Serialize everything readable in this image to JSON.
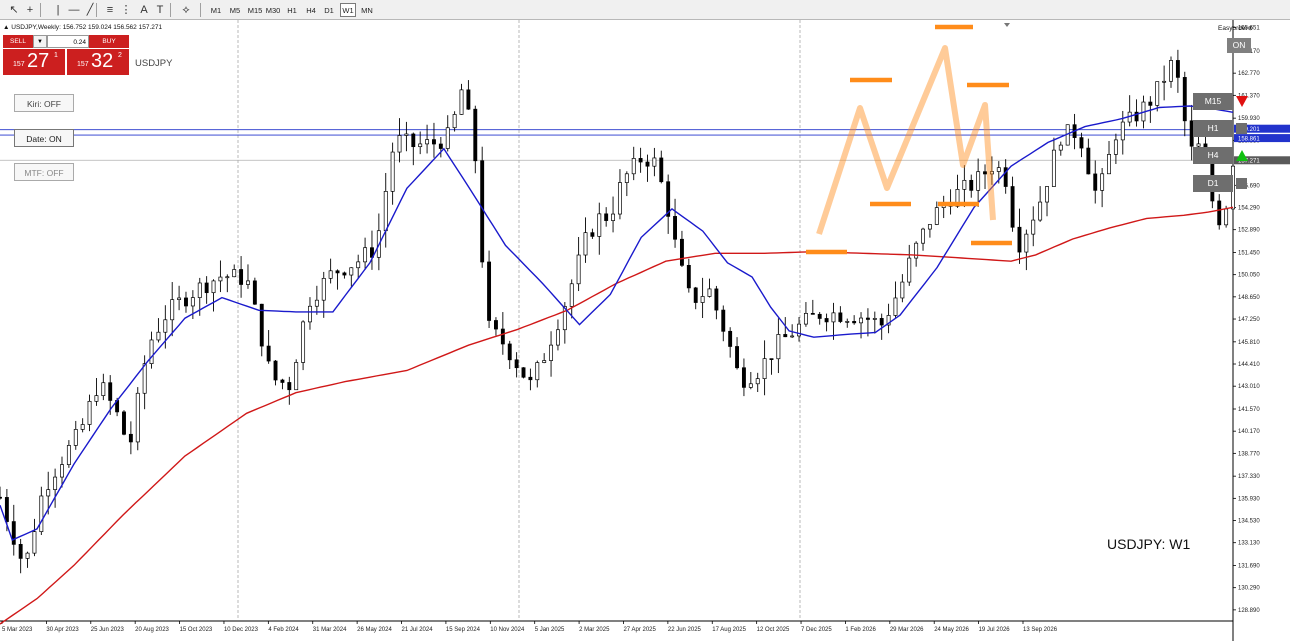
{
  "toolbar": {
    "tools": [
      "cursor-icon",
      "crosshair-icon",
      "vertical-line-icon",
      "horizontal-line-icon",
      "trendline-icon",
      "channel-icon",
      "fibonacci-icon",
      "text-icon",
      "label-icon",
      "shapes-icon"
    ],
    "timeframes": [
      "M1",
      "M5",
      "M15",
      "M30",
      "H1",
      "H4",
      "D1",
      "W1",
      "MN"
    ],
    "active_timeframe": "W1"
  },
  "chart": {
    "title": "USDJPY,Weekly",
    "ohlc": "156.752 159.024 156.562 157.271",
    "symbol": "USDJPY",
    "caption": "USDJPY: W1"
  },
  "trade_panel": {
    "sell_label": "SELL",
    "buy_label": "BUY",
    "lot": "0.24",
    "dropdown_icon": "▼",
    "sell_price_prefix": "157",
    "sell_price_big": "27",
    "sell_price_sup": "1",
    "buy_price_prefix": "157",
    "buy_price_big": "32",
    "buy_price_sup": "2"
  },
  "left_buttons": {
    "kiri": "Kiri: OFF",
    "date": "Date: ON",
    "mtf": "MTF: OFF"
  },
  "easyorder": {
    "label": "Easyorder",
    "on_label": "ON"
  },
  "mtf_panel": [
    {
      "label": "M15",
      "signal": "down",
      "color": "#e01010"
    },
    {
      "label": "H1",
      "signal": "neutral",
      "color": "#6e6e6e"
    },
    {
      "label": "H4",
      "signal": "up",
      "color": "#10c010"
    },
    {
      "label": "D1",
      "signal": "neutral",
      "color": "#6e6e6e"
    }
  ],
  "price_axis": [
    "165.651",
    "164.170",
    "162.770",
    "161.370",
    "159.930",
    "158.530",
    "155.690",
    "154.290",
    "152.890",
    "151.450",
    "150.050",
    "148.650",
    "147.250",
    "145.810",
    "144.410",
    "143.010",
    "141.570",
    "140.170",
    "138.770",
    "137.330",
    "135.930",
    "134.530",
    "133.130",
    "131.690",
    "130.290",
    "128.890"
  ],
  "price_markers": {
    "upper": "159.201",
    "upper2": "158.861",
    "current": "157.271"
  },
  "time_axis": [
    "5 Mar 2023",
    "30 Apr 2023",
    "25 Jun 2023",
    "20 Aug 2023",
    "15 Oct 2023",
    "10 Dec 2023",
    "4 Feb 2024",
    "31 Mar 2024",
    "26 May 2024",
    "21 Jul 2024",
    "15 Sep 2024",
    "10 Nov 2024",
    "5 Jan 2025",
    "2 Mar 2025",
    "27 Apr 2025",
    "22 Jun 2025",
    "17 Aug 2025",
    "12 Oct 2025",
    "7 Dec 2025",
    "1 Feb 2026",
    "29 Mar 2026",
    "24 May 2026",
    "19 Jul 2026",
    "13 Sep 2026"
  ],
  "chart_data": {
    "type": "candlestick",
    "y_range": [
      128.25,
      166.0
    ],
    "ma_fast_color": "#1a1acc",
    "ma_slow_color": "#d01818",
    "pattern_color": "#ff8c1a",
    "ma_fast_key": [
      [
        0,
        135.5
      ],
      [
        10,
        133.3
      ],
      [
        30,
        134.0
      ],
      [
        60,
        138.1
      ],
      [
        90,
        141.6
      ],
      [
        120,
        144.6
      ],
      [
        150,
        147.3
      ],
      [
        180,
        148.6
      ],
      [
        210,
        147.8
      ],
      [
        240,
        147.7
      ],
      [
        270,
        147.7
      ],
      [
        300,
        150.8
      ],
      [
        330,
        155.5
      ],
      [
        360,
        158.0
      ],
      [
        380,
        155.6
      ],
      [
        410,
        151.9
      ],
      [
        440,
        149.5
      ],
      [
        470,
        146.9
      ],
      [
        495,
        148.8
      ],
      [
        520,
        152.4
      ],
      [
        545,
        154.2
      ],
      [
        570,
        152.8
      ],
      [
        590,
        150.8
      ],
      [
        610,
        149.9
      ],
      [
        625,
        148.0
      ],
      [
        640,
        146.5
      ],
      [
        660,
        146.1
      ],
      [
        690,
        146.3
      ],
      [
        710,
        146.4
      ],
      [
        730,
        147.5
      ],
      [
        760,
        150.5
      ],
      [
        790,
        154.3
      ],
      [
        820,
        156.9
      ],
      [
        850,
        158.4
      ],
      [
        880,
        159.4
      ],
      [
        910,
        159.9
      ],
      [
        940,
        160.6
      ],
      [
        965,
        160.7
      ],
      [
        985,
        160.5
      ],
      [
        1000,
        160.3
      ]
    ],
    "ma_slow_key": [
      [
        0,
        128.0
      ],
      [
        30,
        129.6
      ],
      [
        60,
        131.7
      ],
      [
        100,
        134.9
      ],
      [
        150,
        138.6
      ],
      [
        200,
        141.3
      ],
      [
        240,
        142.6
      ],
      [
        280,
        143.3
      ],
      [
        330,
        144.0
      ],
      [
        380,
        145.6
      ],
      [
        420,
        146.6
      ],
      [
        460,
        147.8
      ],
      [
        500,
        149.5
      ],
      [
        540,
        150.9
      ],
      [
        580,
        151.4
      ],
      [
        620,
        151.4
      ],
      [
        660,
        151.5
      ],
      [
        700,
        151.4
      ],
      [
        740,
        151.3
      ],
      [
        780,
        151.1
      ],
      [
        820,
        150.9
      ],
      [
        840,
        151.3
      ],
      [
        870,
        152.3
      ],
      [
        900,
        153.0
      ],
      [
        930,
        153.6
      ],
      [
        960,
        153.8
      ],
      [
        980,
        154.0
      ],
      [
        1000,
        154.3
      ]
    ],
    "close_key": [
      [
        0,
        136.0
      ],
      [
        10,
        133.8
      ],
      [
        20,
        131.5
      ],
      [
        35,
        136.5
      ],
      [
        50,
        138.4
      ],
      [
        65,
        140.1
      ],
      [
        80,
        143.3
      ],
      [
        95,
        141.2
      ],
      [
        105,
        139.1
      ],
      [
        120,
        145.6
      ],
      [
        135,
        147.6
      ],
      [
        150,
        148.6
      ],
      [
        165,
        149.4
      ],
      [
        180,
        150.0
      ],
      [
        200,
        149.8
      ],
      [
        210,
        146.8
      ],
      [
        220,
        143.5
      ],
      [
        235,
        143.1
      ],
      [
        250,
        148.4
      ],
      [
        270,
        150.2
      ],
      [
        290,
        150.9
      ],
      [
        305,
        151.8
      ],
      [
        320,
        158.6
      ],
      [
        335,
        158.2
      ],
      [
        350,
        158.3
      ],
      [
        365,
        158.8
      ],
      [
        375,
        161.9
      ],
      [
        385,
        157.9
      ],
      [
        395,
        146.8
      ],
      [
        410,
        145.6
      ],
      [
        430,
        143.1
      ],
      [
        440,
        144.7
      ],
      [
        460,
        148.6
      ],
      [
        475,
        152.2
      ],
      [
        485,
        153.6
      ],
      [
        495,
        153.8
      ],
      [
        505,
        156.0
      ],
      [
        520,
        157.4
      ],
      [
        530,
        157.3
      ],
      [
        540,
        154.9
      ],
      [
        550,
        151.0
      ],
      [
        560,
        148.4
      ],
      [
        575,
        149.1
      ],
      [
        590,
        146.0
      ],
      [
        600,
        143.4
      ],
      [
        615,
        144.0
      ],
      [
        630,
        145.6
      ],
      [
        650,
        146.9
      ],
      [
        665,
        147.6
      ],
      [
        680,
        147.6
      ],
      [
        700,
        147.4
      ],
      [
        715,
        146.9
      ],
      [
        730,
        149.2
      ],
      [
        740,
        151.3
      ],
      [
        755,
        153.6
      ],
      [
        770,
        154.9
      ],
      [
        790,
        155.8
      ],
      [
        805,
        157.0
      ],
      [
        815,
        156.4
      ],
      [
        825,
        151.8
      ],
      [
        835,
        153.3
      ],
      [
        845,
        155.0
      ],
      [
        860,
        158.8
      ],
      [
        875,
        159.1
      ],
      [
        890,
        154.8
      ],
      [
        905,
        159.0
      ],
      [
        920,
        160.0
      ],
      [
        935,
        161.2
      ],
      [
        950,
        163.3
      ],
      [
        955,
        162.4
      ],
      [
        965,
        157.8
      ],
      [
        975,
        158.2
      ],
      [
        985,
        154.0
      ],
      [
        992,
        153.3
      ],
      [
        1000,
        157.3
      ]
    ]
  }
}
